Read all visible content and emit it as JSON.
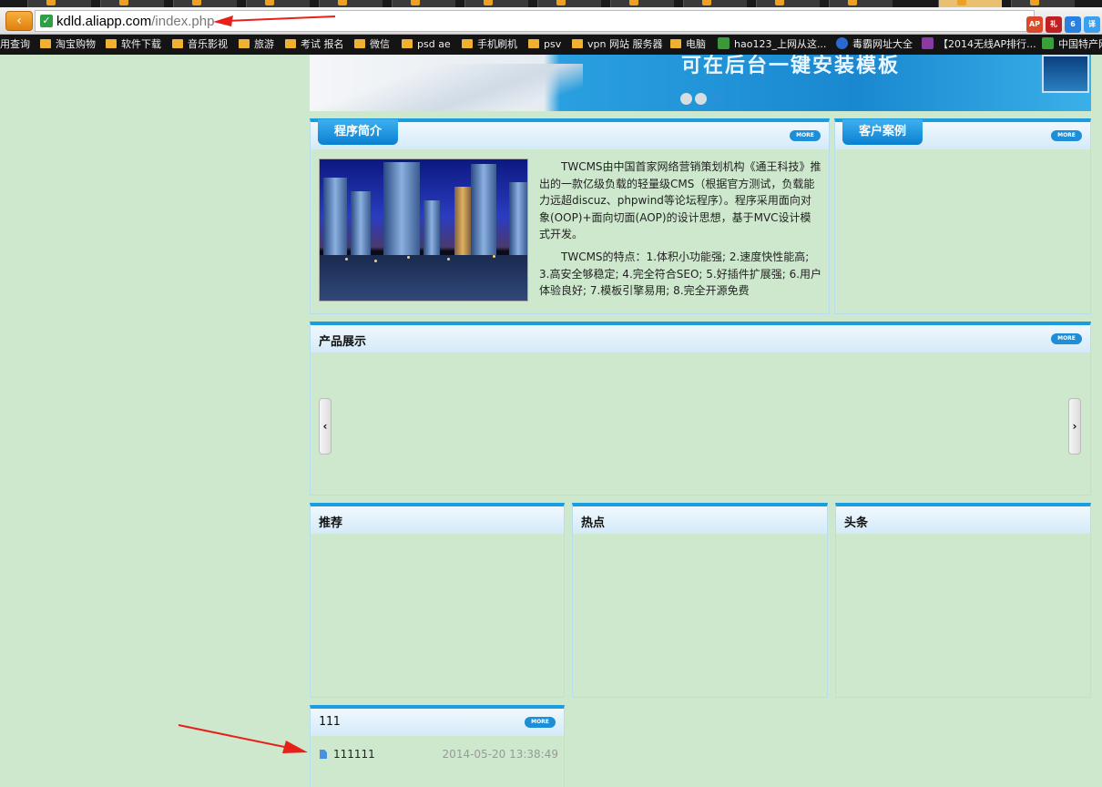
{
  "browser": {
    "url_host": "kdld.aliapp.com",
    "url_path": "/index.php",
    "back_glyph": "‹",
    "secure_glyph": "✓",
    "extensions": [
      {
        "icon": "abp-icon",
        "color": "#d84a2a",
        "label": "AP"
      },
      {
        "icon": "gift-icon",
        "color": "#c02020",
        "label": "礼"
      },
      {
        "icon": "six-icon",
        "color": "#2a80e0",
        "label": "6"
      },
      {
        "icon": "translate-icon",
        "color": "#3aa0f0",
        "label": "译"
      }
    ]
  },
  "bookmarks": [
    {
      "label": "用查询",
      "icon": "none"
    },
    {
      "label": "淘宝购物",
      "icon": "folder-icon"
    },
    {
      "label": "软件下载",
      "icon": "folder-icon"
    },
    {
      "label": "音乐影视",
      "icon": "folder-icon"
    },
    {
      "label": "旅游",
      "icon": "folder-icon"
    },
    {
      "label": "考试 报名",
      "icon": "folder-icon"
    },
    {
      "label": "微信",
      "icon": "folder-icon"
    },
    {
      "label": "psd ae",
      "icon": "folder-icon"
    },
    {
      "label": "手机刷机",
      "icon": "folder-icon"
    },
    {
      "label": "psv",
      "icon": "folder-icon"
    },
    {
      "label": "vpn 网站 服务器",
      "icon": "folder-icon"
    },
    {
      "label": "电脑",
      "icon": "folder-icon"
    },
    {
      "label": "hao123_上网从这...",
      "icon": "picks-icon"
    },
    {
      "label": "毒霸网址大全",
      "icon": "k-icon"
    },
    {
      "label": "【2014无线AP排行...",
      "icon": "flag-icon"
    },
    {
      "label": "中国特产网",
      "icon": "te-icon"
    }
  ],
  "banner": {
    "text": "可在后台一键安装模板",
    "dots": [
      false,
      false,
      true
    ]
  },
  "intro": {
    "title": "程序简介",
    "more": "MORE",
    "paragraphs": [
      "TWCMS由中国首家网络营销策划机构《通王科技》推出的一款亿级负载的轻量级CMS（根据官方测试，负载能力远超discuz、phpwind等论坛程序）。程序采用面向对象(OOP)+面向切面(AOP)的设计思想，基于MVC设计模式开发。",
      "TWCMS的特点：1.体积小功能强; 2.速度快性能高; 3.高安全够稳定; 4.完全符合SEO; 5.好插件扩展强; 6.用户体验良好; 7.模板引擎易用; 8.完全开源免费"
    ]
  },
  "cases": {
    "title": "客户案例",
    "more": "MORE"
  },
  "products": {
    "title": "产品展示",
    "more": "MORE",
    "prev": "‹",
    "next": "›"
  },
  "recommend": {
    "title": "推荐"
  },
  "hot": {
    "title": "热点"
  },
  "headline": {
    "title": "头条"
  },
  "category": {
    "title": "111",
    "more": "MORE",
    "items": [
      {
        "title": "111111",
        "date": "2014-05-20 13:38:49"
      }
    ]
  },
  "annotations": {
    "arrow_color": "#e8201a"
  }
}
